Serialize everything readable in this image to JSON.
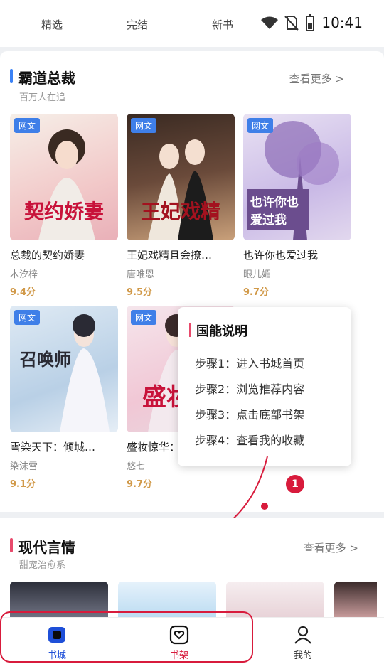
{
  "status_bar": {
    "time": "10:41"
  },
  "top_tabs": [
    "精选",
    "完结",
    "新书"
  ],
  "section1": {
    "title": "霸道总裁",
    "subtitle": "百万人在追",
    "more": "查看更多 >",
    "books": [
      {
        "tag": "网文",
        "cover_text": "契约娇妻",
        "name": "总裁的契约娇妻",
        "author": "木汐梓",
        "score": "9.4分"
      },
      {
        "tag": "网文",
        "cover_text": "王妃戏精",
        "name": "王妃戏精且会撩…",
        "author": "唐唯恩",
        "score": "9.5分"
      },
      {
        "tag": "网文",
        "cover_text": "也许你也爱过我",
        "name": "也许你也爱过我",
        "author": "眼儿媚",
        "score": "9.7分"
      },
      {
        "tag": "网文",
        "cover_text": "召唤师",
        "name": "雪染天下：倾城…",
        "author": "染沫雪",
        "score": "9.1分"
      },
      {
        "tag": "网文",
        "cover_text": "盛妆",
        "name": "盛妆惊华：",
        "author": "悠七",
        "score": "9.7分"
      }
    ]
  },
  "tooltip": {
    "title": "国能说明",
    "steps": [
      "步骤1：进入书城首页",
      "步骤2：浏览推荐内容",
      "步骤3：点击底部书架",
      "步骤4：查看我的收藏"
    ]
  },
  "badges": {
    "b1": "1",
    "b2": "1"
  },
  "section2": {
    "title": "现代言情",
    "subtitle": "甜宠治愈系",
    "more": "查看更多 >"
  },
  "bottom_nav": [
    {
      "label": "书城"
    },
    {
      "label": "书架"
    },
    {
      "label": "我的"
    }
  ],
  "colors": {
    "accent_blue": "#3f7fe8",
    "highlight_red": "#d81b3c",
    "score": "#d19a4a"
  }
}
